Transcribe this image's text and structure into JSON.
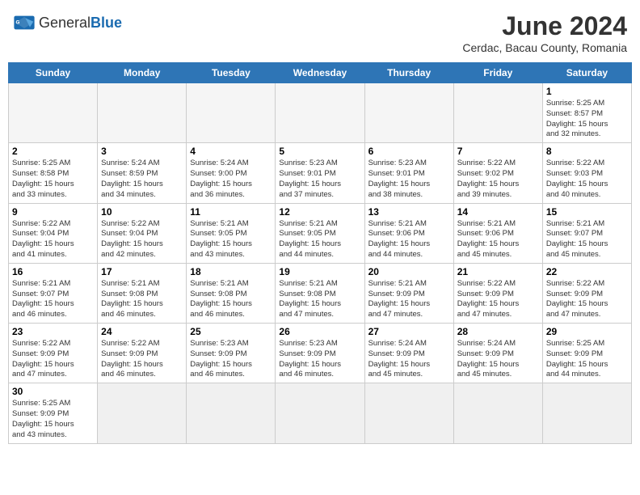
{
  "header": {
    "logo_general": "General",
    "logo_blue": "Blue",
    "title": "June 2024",
    "subtitle": "Cerdac, Bacau County, Romania"
  },
  "weekdays": [
    "Sunday",
    "Monday",
    "Tuesday",
    "Wednesday",
    "Thursday",
    "Friday",
    "Saturday"
  ],
  "weeks": [
    [
      {
        "day": "",
        "empty": true
      },
      {
        "day": "",
        "empty": true
      },
      {
        "day": "",
        "empty": true
      },
      {
        "day": "",
        "empty": true
      },
      {
        "day": "",
        "empty": true
      },
      {
        "day": "",
        "empty": true
      },
      {
        "day": "1",
        "info": "Sunrise: 5:25 AM\nSunset: 8:57 PM\nDaylight: 15 hours\nand 32 minutes."
      }
    ],
    [
      {
        "day": "2",
        "info": "Sunrise: 5:25 AM\nSunset: 8:58 PM\nDaylight: 15 hours\nand 33 minutes."
      },
      {
        "day": "3",
        "info": "Sunrise: 5:24 AM\nSunset: 8:59 PM\nDaylight: 15 hours\nand 34 minutes."
      },
      {
        "day": "4",
        "info": "Sunrise: 5:24 AM\nSunset: 9:00 PM\nDaylight: 15 hours\nand 36 minutes."
      },
      {
        "day": "5",
        "info": "Sunrise: 5:23 AM\nSunset: 9:01 PM\nDaylight: 15 hours\nand 37 minutes."
      },
      {
        "day": "6",
        "info": "Sunrise: 5:23 AM\nSunset: 9:01 PM\nDaylight: 15 hours\nand 38 minutes."
      },
      {
        "day": "7",
        "info": "Sunrise: 5:22 AM\nSunset: 9:02 PM\nDaylight: 15 hours\nand 39 minutes."
      },
      {
        "day": "8",
        "info": "Sunrise: 5:22 AM\nSunset: 9:03 PM\nDaylight: 15 hours\nand 40 minutes."
      }
    ],
    [
      {
        "day": "9",
        "info": "Sunrise: 5:22 AM\nSunset: 9:04 PM\nDaylight: 15 hours\nand 41 minutes."
      },
      {
        "day": "10",
        "info": "Sunrise: 5:22 AM\nSunset: 9:04 PM\nDaylight: 15 hours\nand 42 minutes."
      },
      {
        "day": "11",
        "info": "Sunrise: 5:21 AM\nSunset: 9:05 PM\nDaylight: 15 hours\nand 43 minutes."
      },
      {
        "day": "12",
        "info": "Sunrise: 5:21 AM\nSunset: 9:05 PM\nDaylight: 15 hours\nand 44 minutes."
      },
      {
        "day": "13",
        "info": "Sunrise: 5:21 AM\nSunset: 9:06 PM\nDaylight: 15 hours\nand 44 minutes."
      },
      {
        "day": "14",
        "info": "Sunrise: 5:21 AM\nSunset: 9:06 PM\nDaylight: 15 hours\nand 45 minutes."
      },
      {
        "day": "15",
        "info": "Sunrise: 5:21 AM\nSunset: 9:07 PM\nDaylight: 15 hours\nand 45 minutes."
      }
    ],
    [
      {
        "day": "16",
        "info": "Sunrise: 5:21 AM\nSunset: 9:07 PM\nDaylight: 15 hours\nand 46 minutes."
      },
      {
        "day": "17",
        "info": "Sunrise: 5:21 AM\nSunset: 9:08 PM\nDaylight: 15 hours\nand 46 minutes."
      },
      {
        "day": "18",
        "info": "Sunrise: 5:21 AM\nSunset: 9:08 PM\nDaylight: 15 hours\nand 46 minutes."
      },
      {
        "day": "19",
        "info": "Sunrise: 5:21 AM\nSunset: 9:08 PM\nDaylight: 15 hours\nand 47 minutes."
      },
      {
        "day": "20",
        "info": "Sunrise: 5:21 AM\nSunset: 9:09 PM\nDaylight: 15 hours\nand 47 minutes."
      },
      {
        "day": "21",
        "info": "Sunrise: 5:22 AM\nSunset: 9:09 PM\nDaylight: 15 hours\nand 47 minutes."
      },
      {
        "day": "22",
        "info": "Sunrise: 5:22 AM\nSunset: 9:09 PM\nDaylight: 15 hours\nand 47 minutes."
      }
    ],
    [
      {
        "day": "23",
        "info": "Sunrise: 5:22 AM\nSunset: 9:09 PM\nDaylight: 15 hours\nand 47 minutes."
      },
      {
        "day": "24",
        "info": "Sunrise: 5:22 AM\nSunset: 9:09 PM\nDaylight: 15 hours\nand 46 minutes."
      },
      {
        "day": "25",
        "info": "Sunrise: 5:23 AM\nSunset: 9:09 PM\nDaylight: 15 hours\nand 46 minutes."
      },
      {
        "day": "26",
        "info": "Sunrise: 5:23 AM\nSunset: 9:09 PM\nDaylight: 15 hours\nand 46 minutes."
      },
      {
        "day": "27",
        "info": "Sunrise: 5:24 AM\nSunset: 9:09 PM\nDaylight: 15 hours\nand 45 minutes."
      },
      {
        "day": "28",
        "info": "Sunrise: 5:24 AM\nSunset: 9:09 PM\nDaylight: 15 hours\nand 45 minutes."
      },
      {
        "day": "29",
        "info": "Sunrise: 5:25 AM\nSunset: 9:09 PM\nDaylight: 15 hours\nand 44 minutes."
      }
    ],
    [
      {
        "day": "30",
        "info": "Sunrise: 5:25 AM\nSunset: 9:09 PM\nDaylight: 15 hours\nand 43 minutes."
      },
      {
        "day": "",
        "empty": true
      },
      {
        "day": "",
        "empty": true
      },
      {
        "day": "",
        "empty": true
      },
      {
        "day": "",
        "empty": true
      },
      {
        "day": "",
        "empty": true
      },
      {
        "day": "",
        "empty": true
      }
    ]
  ]
}
